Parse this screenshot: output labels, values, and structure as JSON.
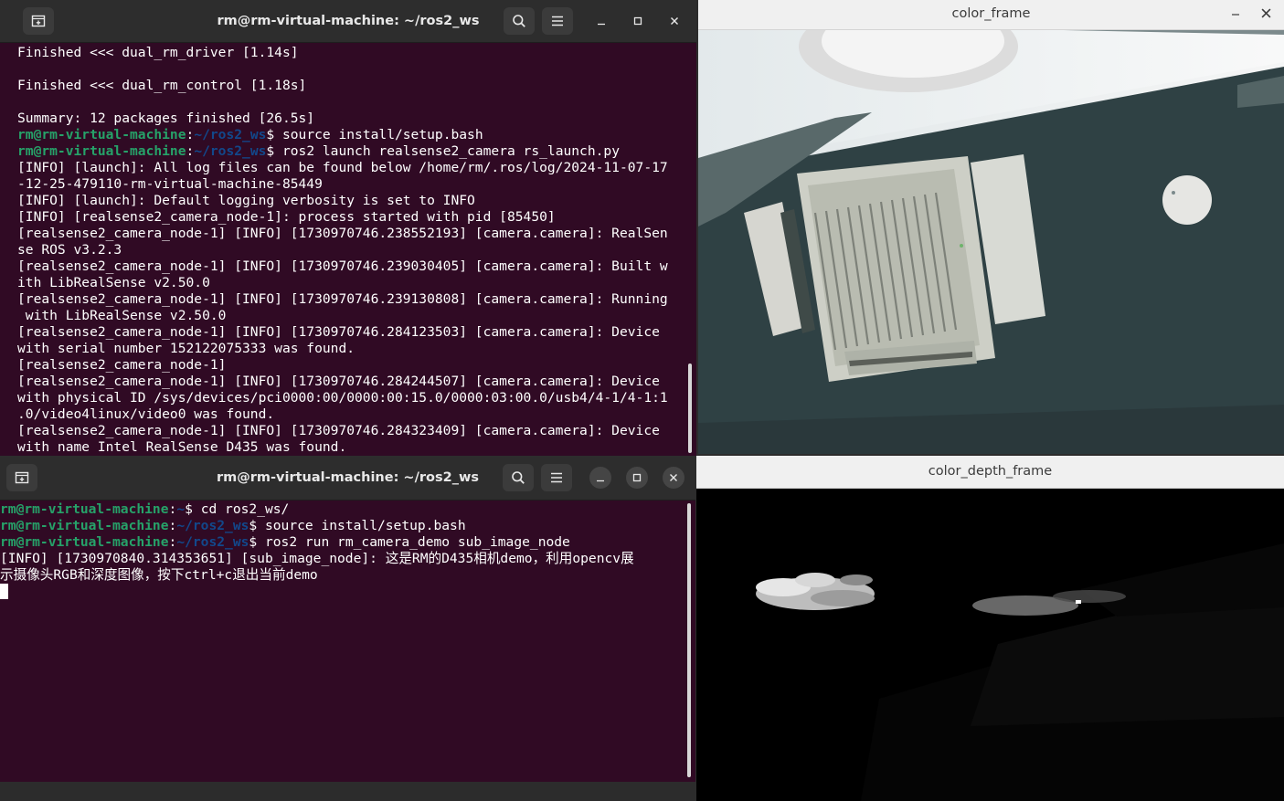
{
  "terminal1": {
    "title": "rm@rm-virtual-machine: ~/ros2_ws",
    "lines": [
      {
        "text": "Finished <<< dual_rm_driver [1.14s]"
      },
      {
        "text": ""
      },
      {
        "text": "Finished <<< dual_rm_control [1.18s]"
      },
      {
        "text": ""
      },
      {
        "text": "Summary: 12 packages finished [26.5s]"
      },
      {
        "prompt_user": "rm@rm-virtual-machine",
        "prompt_sep": ":",
        "prompt_path": "~/ros2_ws",
        "prompt_end": "$ ",
        "text": "source install/setup.bash"
      },
      {
        "prompt_user": "rm@rm-virtual-machine",
        "prompt_sep": ":",
        "prompt_path": "~/ros2_ws",
        "prompt_end": "$ ",
        "text": "ros2 launch realsense2_camera rs_launch.py"
      },
      {
        "text": "[INFO] [launch]: All log files can be found below /home/rm/.ros/log/2024-11-07-17"
      },
      {
        "text": "-12-25-479110-rm-virtual-machine-85449"
      },
      {
        "text": "[INFO] [launch]: Default logging verbosity is set to INFO"
      },
      {
        "text": "[INFO] [realsense2_camera_node-1]: process started with pid [85450]"
      },
      {
        "text": "[realsense2_camera_node-1] [INFO] [1730970746.238552193] [camera.camera]: RealSen"
      },
      {
        "text": "se ROS v3.2.3"
      },
      {
        "text": "[realsense2_camera_node-1] [INFO] [1730970746.239030405] [camera.camera]: Built w"
      },
      {
        "text": "ith LibRealSense v2.50.0"
      },
      {
        "text": "[realsense2_camera_node-1] [INFO] [1730970746.239130808] [camera.camera]: Running"
      },
      {
        "text": " with LibRealSense v2.50.0"
      },
      {
        "text": "[realsense2_camera_node-1] [INFO] [1730970746.284123503] [camera.camera]: Device"
      },
      {
        "text": "with serial number 152122075333 was found."
      },
      {
        "text": "[realsense2_camera_node-1]"
      },
      {
        "text": "[realsense2_camera_node-1] [INFO] [1730970746.284244507] [camera.camera]: Device"
      },
      {
        "text": "with physical ID /sys/devices/pci0000:00/0000:00:15.0/0000:03:00.0/usb4/4-1/4-1:1"
      },
      {
        "text": ".0/video4linux/video0 was found."
      },
      {
        "text": "[realsense2_camera_node-1] [INFO] [1730970746.284323409] [camera.camera]: Device"
      },
      {
        "text": "with name Intel RealSense D435 was found."
      }
    ]
  },
  "terminal2": {
    "title": "rm@rm-virtual-machine: ~/ros2_ws",
    "lines": [
      {
        "prompt_user": "rm@rm-virtual-machine",
        "prompt_sep": ":",
        "prompt_path": "~",
        "prompt_end": "$ ",
        "text": "cd ros2_ws/"
      },
      {
        "prompt_user": "rm@rm-virtual-machine",
        "prompt_sep": ":",
        "prompt_path": "~/ros2_ws",
        "prompt_end": "$ ",
        "text": "source install/setup.bash"
      },
      {
        "prompt_user": "rm@rm-virtual-machine",
        "prompt_sep": ":",
        "prompt_path": "~/ros2_ws",
        "prompt_end": "$ ",
        "text": "ros2 run rm_camera_demo sub_image_node"
      },
      {
        "text": "[INFO] [1730970840.314353651] [sub_image_node]: 这是RM的D435相机demo，利用opencv展"
      },
      {
        "text": "示摄像头RGB和深度图像，按下ctrl+c退出当前demo"
      }
    ]
  },
  "color_frame": {
    "title": "color_frame"
  },
  "depth_frame": {
    "title": "color_depth_frame"
  },
  "colors": {
    "terminal_bg": "#300a24",
    "prompt_user": "#26a269",
    "prompt_path": "#12488b",
    "titlebar_dark": "#2d2d2d",
    "titlebar_light": "#f0f0f0"
  },
  "icons": [
    "new-tab-icon",
    "search-icon",
    "menu-icon",
    "minimize-icon",
    "maximize-icon",
    "close-icon"
  ]
}
